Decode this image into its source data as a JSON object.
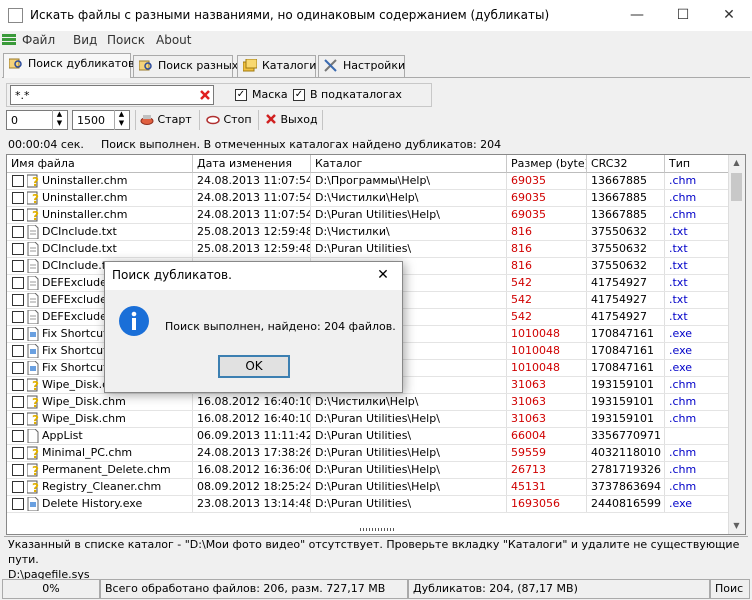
{
  "window": {
    "title": "Искать файлы с разными названиями, но одинаковым содержанием (дубликаты)",
    "controls": {
      "minimize": "—",
      "maximize": "☐",
      "close": "✕"
    }
  },
  "menu": [
    "Файл",
    "Вид",
    "Поиск",
    "About"
  ],
  "tabs": [
    {
      "label": "Поиск дубликатов",
      "active": true
    },
    {
      "label": "Поиск разных",
      "active": false
    },
    {
      "label": "Каталоги",
      "active": false
    },
    {
      "label": "Настройки",
      "active": false
    }
  ],
  "filter": {
    "mask_value": "*.*",
    "mask_checkbox_label": "Маска",
    "mask_checked": true,
    "subdirs_checkbox_label": "В подкаталогах",
    "subdirs_checked": true
  },
  "size_range": {
    "min": "0",
    "max": "1500"
  },
  "toolbar": {
    "start": "Старт",
    "stop": "Стоп",
    "exit": "Выход"
  },
  "info": {
    "elapsed": "00:00:04 сек.",
    "message": "Поиск выполнен. В отмеченных каталогах найдено дубликатов: 204"
  },
  "table": {
    "columns": [
      "Имя файла",
      "Дата изменения",
      "Каталог",
      "Размер (byte)",
      "CRC32",
      "Тип"
    ],
    "rows": [
      {
        "name": "Uninstaller.chm",
        "date": "24.08.2013 11:07:54",
        "dir": "D:\\Программы\\Help\\",
        "size": "69035",
        "crc": "13667885",
        "type": ".chm",
        "icon": "chm"
      },
      {
        "name": "Uninstaller.chm",
        "date": "24.08.2013 11:07:54",
        "dir": "D:\\Чистилки\\Help\\",
        "size": "69035",
        "crc": "13667885",
        "type": ".chm",
        "icon": "chm"
      },
      {
        "name": "Uninstaller.chm",
        "date": "24.08.2013 11:07:54",
        "dir": "D:\\Puran Utilities\\Help\\",
        "size": "69035",
        "crc": "13667885",
        "type": ".chm",
        "icon": "chm"
      },
      {
        "name": "DCInclude.txt",
        "date": "25.08.2013 12:59:48",
        "dir": "D:\\Чистилки\\",
        "size": "816",
        "crc": "37550632",
        "type": ".txt",
        "icon": "txt"
      },
      {
        "name": "DCInclude.txt",
        "date": "25.08.2013 12:59:48",
        "dir": "D:\\Puran Utilities\\",
        "size": "816",
        "crc": "37550632",
        "type": ".txt",
        "icon": "txt"
      },
      {
        "name": "DCInclude.txt",
        "date": "",
        "dir": "",
        "size": "816",
        "crc": "37550632",
        "type": ".txt",
        "icon": "txt"
      },
      {
        "name": "DEFExclude.",
        "date": "",
        "dir": "",
        "size": "542",
        "crc": "41754927",
        "type": ".txt",
        "icon": "txt"
      },
      {
        "name": "DEFExclude.",
        "date": "",
        "dir": "",
        "size": "542",
        "crc": "41754927",
        "type": ".txt",
        "icon": "txt"
      },
      {
        "name": "DEFExclude.",
        "date": "",
        "dir": "",
        "size": "542",
        "crc": "41754927",
        "type": ".txt",
        "icon": "txt"
      },
      {
        "name": "Fix Shortcuts",
        "date": "",
        "dir": "",
        "size": "1010048",
        "crc": "170847161",
        "type": ".exe",
        "icon": "exe"
      },
      {
        "name": "Fix Shortcuts",
        "date": "",
        "dir": "",
        "size": "1010048",
        "crc": "170847161",
        "type": ".exe",
        "icon": "exe"
      },
      {
        "name": "Fix Shortcuts",
        "date": "",
        "dir": "",
        "size": "1010048",
        "crc": "170847161",
        "type": ".exe",
        "icon": "exe"
      },
      {
        "name": "Wipe_Disk.chm",
        "date": "",
        "dir": "Help\\",
        "size": "31063",
        "crc": "193159101",
        "type": ".chm",
        "icon": "chm"
      },
      {
        "name": "Wipe_Disk.chm",
        "date": "16.08.2012 16:40:10",
        "dir": "D:\\Чистилки\\Help\\",
        "size": "31063",
        "crc": "193159101",
        "type": ".chm",
        "icon": "chm"
      },
      {
        "name": "Wipe_Disk.chm",
        "date": "16.08.2012 16:40:10",
        "dir": "D:\\Puran Utilities\\Help\\",
        "size": "31063",
        "crc": "193159101",
        "type": ".chm",
        "icon": "chm"
      },
      {
        "name": "AppList",
        "date": "06.09.2013 11:11:42",
        "dir": "D:\\Puran Utilities\\",
        "size": "66004",
        "crc": "3356770971",
        "type": "",
        "icon": "file"
      },
      {
        "name": "Minimal_PC.chm",
        "date": "24.08.2013 17:38:26",
        "dir": "D:\\Puran Utilities\\Help\\",
        "size": "59559",
        "crc": "4032118010",
        "type": ".chm",
        "icon": "chm"
      },
      {
        "name": "Permanent_Delete.chm",
        "date": "16.08.2012 16:36:06",
        "dir": "D:\\Puran Utilities\\Help\\",
        "size": "26713",
        "crc": "2781719326",
        "type": ".chm",
        "icon": "chm"
      },
      {
        "name": "Registry_Cleaner.chm",
        "date": "08.09.2012 18:25:24",
        "dir": "D:\\Puran Utilities\\Help\\",
        "size": "45131",
        "crc": "3737863694",
        "type": ".chm",
        "icon": "chm"
      },
      {
        "name": "Delete History.exe",
        "date": "23.08.2013 13:14:48",
        "dir": "D:\\Puran Utilities\\",
        "size": "1693056",
        "crc": "2440816599",
        "type": ".exe",
        "icon": "exe"
      }
    ]
  },
  "log_lines": [
    "Указанный в списке каталог - \"D:\\Мои фото видео\" отсутствует. Проверьте вкладку \"Каталоги\" и удалите не существующие пути.",
    "D:\\pagefile.sys"
  ],
  "statusbar": {
    "progress": "0%",
    "processed": "Всего обработано файлов: 206, разм. 727,17 MB",
    "duplicates": "Дубликатов: 204,  (87,17 MB)",
    "extra": "Поис"
  },
  "dialog": {
    "title": "Поиск дубликатов.",
    "message": "Поиск выполнен, найдено: 204 файлов.",
    "ok": "OK",
    "close": "✕"
  },
  "colors": {
    "size_red": "#d00000",
    "type_blue": "#0000c8",
    "dialog_icon": "#1a6fd8",
    "ok_border": "#3c7fb1"
  }
}
